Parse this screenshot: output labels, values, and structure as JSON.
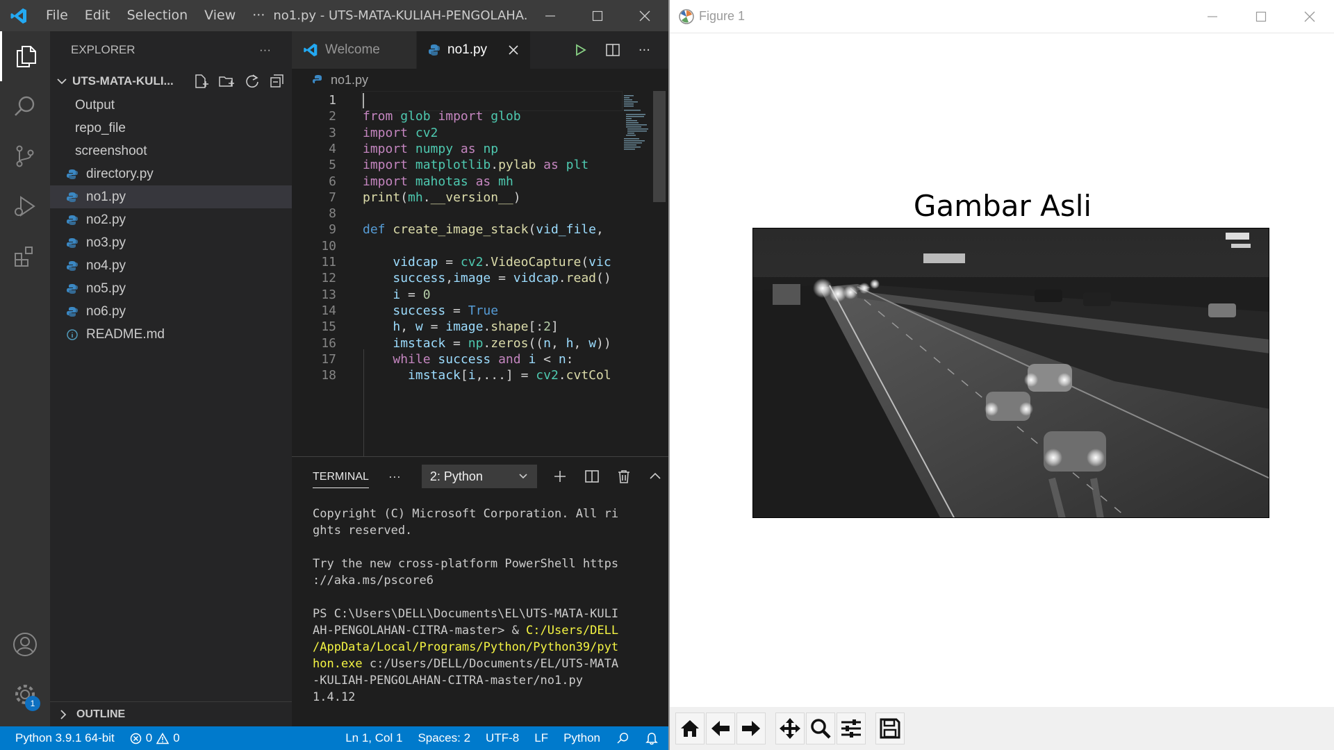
{
  "vscode": {
    "menu": [
      "File",
      "Edit",
      "Selection",
      "View",
      "···"
    ],
    "window_title": "no1.py - UTS-MATA-KULIAH-PENGOLAHA...",
    "explorer": {
      "header": "EXPLORER",
      "more": "···",
      "folder": "UTS-MATA-KULI...",
      "items": [
        {
          "label": "Output",
          "type": "folder"
        },
        {
          "label": "repo_file",
          "type": "folder"
        },
        {
          "label": "screenshoot",
          "type": "folder"
        },
        {
          "label": "directory.py",
          "type": "python"
        },
        {
          "label": "no1.py",
          "type": "python"
        },
        {
          "label": "no2.py",
          "type": "python"
        },
        {
          "label": "no3.py",
          "type": "python"
        },
        {
          "label": "no4.py",
          "type": "python"
        },
        {
          "label": "no5.py",
          "type": "python"
        },
        {
          "label": "no6.py",
          "type": "python"
        },
        {
          "label": "README.md",
          "type": "info"
        }
      ],
      "selected_index": 4,
      "outline": "OUTLINE"
    },
    "tabs": [
      {
        "label": "Welcome",
        "active": false
      },
      {
        "label": "no1.py",
        "active": true
      }
    ],
    "tab_tools_more": "···",
    "breadcrumb": "no1.py",
    "code_lines": [
      {
        "n": "1",
        "code": ""
      },
      {
        "n": "2",
        "code": "from glob import glob"
      },
      {
        "n": "3",
        "code": "import cv2"
      },
      {
        "n": "4",
        "code": "import numpy as np"
      },
      {
        "n": "5",
        "code": "import matplotlib.pylab as plt"
      },
      {
        "n": "6",
        "code": "import mahotas as mh"
      },
      {
        "n": "7",
        "code": "print(mh.__version__)"
      },
      {
        "n": "8",
        "code": ""
      },
      {
        "n": "9",
        "code": "def create_image_stack(vid_file,"
      },
      {
        "n": "10",
        "code": ""
      },
      {
        "n": "11",
        "code": "    vidcap = cv2.VideoCapture(vic"
      },
      {
        "n": "12",
        "code": "    success,image = vidcap.read()"
      },
      {
        "n": "13",
        "code": "    i = 0"
      },
      {
        "n": "14",
        "code": "    success = True"
      },
      {
        "n": "15",
        "code": "    h, w = image.shape[:2]"
      },
      {
        "n": "16",
        "code": "    imstack = np.zeros((n, h, w))"
      },
      {
        "n": "17",
        "code": "    while success and i < n:"
      },
      {
        "n": "18",
        "code": "      imstack[i,...] = cv2.cvtCol"
      }
    ],
    "panel": {
      "tab": "TERMINAL",
      "more": "···",
      "select": "2: Python",
      "terminal_lines": [
        {
          "text": "Copyright (C) Microsoft Corporation. All ri",
          "hl": ""
        },
        {
          "text": "ghts reserved.",
          "hl": ""
        },
        {
          "text": "",
          "hl": ""
        },
        {
          "text": "Try the new cross-platform PowerShell https",
          "hl": ""
        },
        {
          "text": "://aka.ms/pscore6",
          "hl": ""
        },
        {
          "text": "",
          "hl": ""
        },
        {
          "text": "PS C:\\Users\\DELL\\Documents\\EL\\UTS-MATA-KULI",
          "hl": ""
        },
        {
          "text": "AH-PENGOLAHAN-CITRA-master> & ",
          "hl": "C:/Users/DELL"
        },
        {
          "text": "",
          "hl": "/AppData/Local/Programs/Python/Python39/pyt"
        },
        {
          "text": " c:/Users/DELL/Documents/EL/UTS-MATA",
          "hl": "hon.exe",
          "hl_first": true
        },
        {
          "text": "-KULIAH-PENGOLAHAN-CITRA-master/no1.py",
          "hl": ""
        },
        {
          "text": "1.4.12",
          "hl": ""
        }
      ]
    },
    "status": {
      "python": "Python 3.9.1 64-bit",
      "errors": "0",
      "warnings": "0",
      "position": "Ln 1, Col 1",
      "spaces": "Spaces: 2",
      "encoding": "UTF-8",
      "eol": "LF",
      "language": "Python"
    },
    "settings_badge": "1",
    "colors": {
      "accent": "#007acc",
      "activity_bar": "#333333",
      "sidebar": "#252526",
      "editor": "#1e1e1e"
    }
  },
  "figure": {
    "window_title": "Figure 1",
    "plot_title": "Gambar Asli",
    "image_description_icon": "grayscale-highway-photo",
    "toolbar": [
      "home-icon",
      "back-icon",
      "forward-icon",
      "pan-icon",
      "zoom-icon",
      "configure-subplots-icon",
      "save-icon"
    ]
  }
}
